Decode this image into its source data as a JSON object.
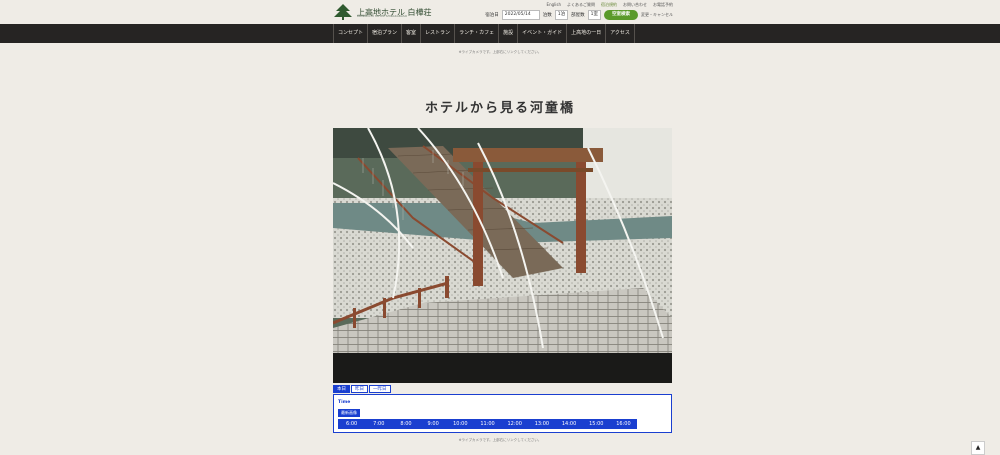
{
  "header": {
    "logo_text": "上高地ホテル 白樺荘",
    "logo_sub": "KAMIKOCHI HOTEL SHIRAKABASO",
    "links": [
      "English",
      "よくあるご質問",
      "宿泊規約",
      "お問い合わせ",
      "お電話予約"
    ],
    "booking": {
      "checkin_label": "宿泊日",
      "checkin_value": "2022/05/14",
      "nights_value": "1泊",
      "nights_label": "泊数",
      "rooms_label": "部屋数",
      "rooms_value": "1室",
      "search_label": "空室検索",
      "confirm_label": "変更・キャンセル"
    }
  },
  "nav": {
    "items": [
      "コンセプト",
      "宿泊プラン",
      "客室",
      "レストラン",
      "ランチ・カフェ",
      "施設",
      "イベント・ガイド",
      "上高地の一日",
      "アクセス"
    ]
  },
  "notes": {
    "top": "※ライブカメラです。上部右にリンクしてください。",
    "bottom": "※ライブカメラです。上部右にリンクしてください。"
  },
  "page": {
    "title": "ホテルから見る河童橋"
  },
  "tabs": [
    {
      "label": "本日",
      "active": true
    },
    {
      "label": "昨日",
      "active": false
    },
    {
      "label": "一昨日",
      "active": false
    }
  ],
  "time_panel": {
    "label": "Time",
    "latest_label": "最新画像",
    "times": [
      "6:00",
      "7:00",
      "8:00",
      "9:00",
      "10:00",
      "11:00",
      "12:00",
      "13:00",
      "14:00",
      "15:00",
      "16:00"
    ]
  },
  "back_to_top": "▲",
  "colors": {
    "background": "#efece6",
    "nav_bg": "#262423",
    "accent_green": "#5a9a2a",
    "time_blue": "#1a3fd0"
  }
}
